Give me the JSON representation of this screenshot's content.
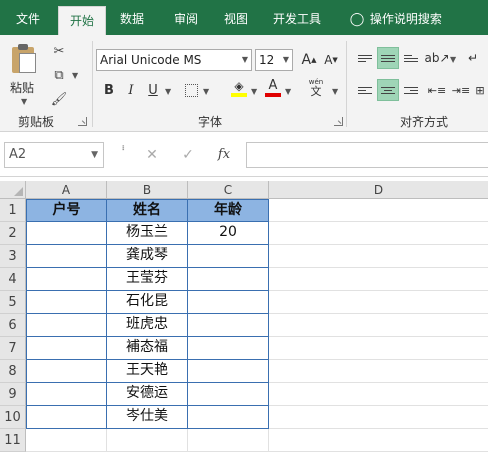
{
  "tabs": {
    "file": "文件",
    "home": "开始",
    "data": "数据",
    "review": "审阅",
    "view": "视图",
    "developer": "开发工具",
    "tell_me": "操作说明搜索"
  },
  "ribbon": {
    "paste_label": "粘贴",
    "clipboard_group": "剪贴板",
    "font_group": "字体",
    "align_group": "对齐方式",
    "font_name": "Arial Unicode MS",
    "font_size": "12",
    "bold": "B",
    "italic": "I",
    "underline": "U",
    "wen_label": "wén",
    "wen_char": "文"
  },
  "formula_bar": {
    "name_box": "A2",
    "fx": "fx",
    "formula": ""
  },
  "grid": {
    "columns": [
      "A",
      "B",
      "C",
      "D"
    ],
    "rows": [
      "1",
      "2",
      "3",
      "4",
      "5",
      "6",
      "7",
      "8",
      "9",
      "10",
      "11"
    ],
    "cells": [
      [
        "户号",
        "姓名",
        "年龄"
      ],
      [
        "",
        "杨玉兰",
        "20"
      ],
      [
        "",
        "龚成琴",
        ""
      ],
      [
        "",
        "王莹芬",
        ""
      ],
      [
        "",
        "石化昆",
        ""
      ],
      [
        "",
        "班虎忠",
        ""
      ],
      [
        "",
        "補态福",
        ""
      ],
      [
        "",
        "王天艳",
        ""
      ],
      [
        "",
        "安德运",
        ""
      ],
      [
        "",
        "岑仕美",
        ""
      ]
    ]
  },
  "colors": {
    "brand": "#217346",
    "header_fill": "#8db4e2",
    "table_border": "#3a6fb0",
    "selected_tool": "#9fd5b7"
  }
}
